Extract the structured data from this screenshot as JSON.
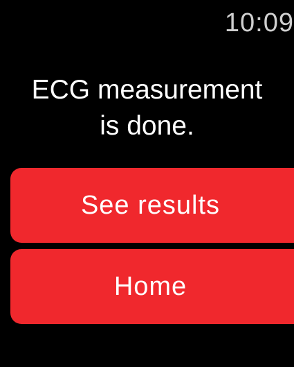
{
  "status_bar": {
    "time": "10:09"
  },
  "message": {
    "line1": "ECG measurement",
    "line2": "is done."
  },
  "buttons": {
    "see_results": "See results",
    "home": "Home"
  },
  "colors": {
    "background": "#000000",
    "button": "#f0282d",
    "text": "#ffffff"
  }
}
